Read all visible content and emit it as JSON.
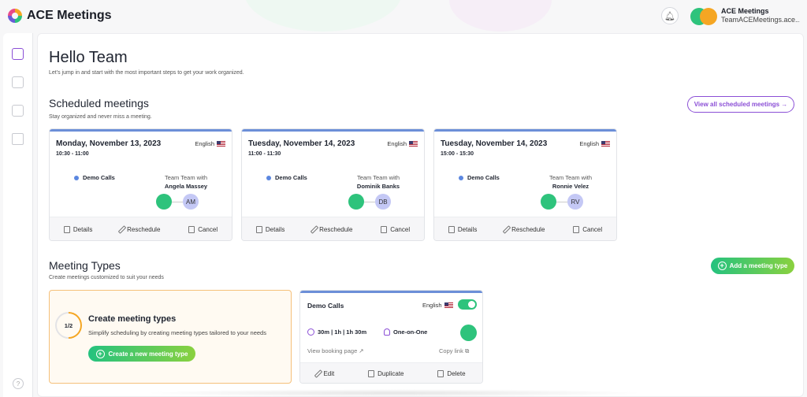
{
  "app": {
    "title": "ACE Meetings"
  },
  "user": {
    "name": "ACE Meetings",
    "email": "TeamACEMeetings.ace..."
  },
  "greeting": {
    "title": "Hello Team",
    "subtitle": "Let's jump in and start with the most important steps to get your work organized."
  },
  "scheduled": {
    "title": "Scheduled meetings",
    "subtitle": "Stay organized and never miss a meeting.",
    "view_all": "View all scheduled meetings →",
    "meetings": [
      {
        "date": "Monday, November 13, 2023",
        "time": "10:30 - 11:00",
        "language": "English",
        "type": "Demo Calls",
        "with": "Team Team with",
        "person": "Angela Massey",
        "initials": "AM"
      },
      {
        "date": "Tuesday, November 14, 2023",
        "time": "11:00 - 11:30",
        "language": "English",
        "type": "Demo Calls",
        "with": "Team Team with",
        "person": "Dominik Banks",
        "initials": "DB"
      },
      {
        "date": "Tuesday, November 14, 2023",
        "time": "15:00 - 15:30",
        "language": "English",
        "type": "Demo Calls",
        "with": "Team Team with",
        "person": "Ronnie Velez",
        "initials": "RV"
      }
    ],
    "actions": {
      "details": "Details",
      "reschedule": "Reschedule",
      "cancel": "Cancel"
    }
  },
  "meeting_types": {
    "title": "Meeting Types",
    "subtitle": "Create meetings customized to suit your needs",
    "add_button": "Add a meeting type",
    "create_card": {
      "progress": "1/2",
      "title": "Create meeting types",
      "subtitle": "Simplify scheduling by creating meeting types tailored to your needs",
      "button": "Create a new meeting type"
    },
    "type_card": {
      "title": "Demo Calls",
      "language": "English",
      "durations": "30m | 1h | 1h 30m",
      "kind": "One-on-One",
      "view_link": "View booking page",
      "copy_link": "Copy link",
      "edit": "Edit",
      "duplicate": "Duplicate",
      "delete": "Delete"
    }
  },
  "colors": {
    "accent": "#8b4fd6",
    "green": "#2ec37c",
    "card_top": "#6c8fd8",
    "orange": "#f5a623"
  },
  "icons": [
    "bell-icon",
    "calendar-icon",
    "grid-icon",
    "sliders-icon",
    "help-icon",
    "clock-icon",
    "person-icon",
    "external-link-icon",
    "copy-icon"
  ]
}
